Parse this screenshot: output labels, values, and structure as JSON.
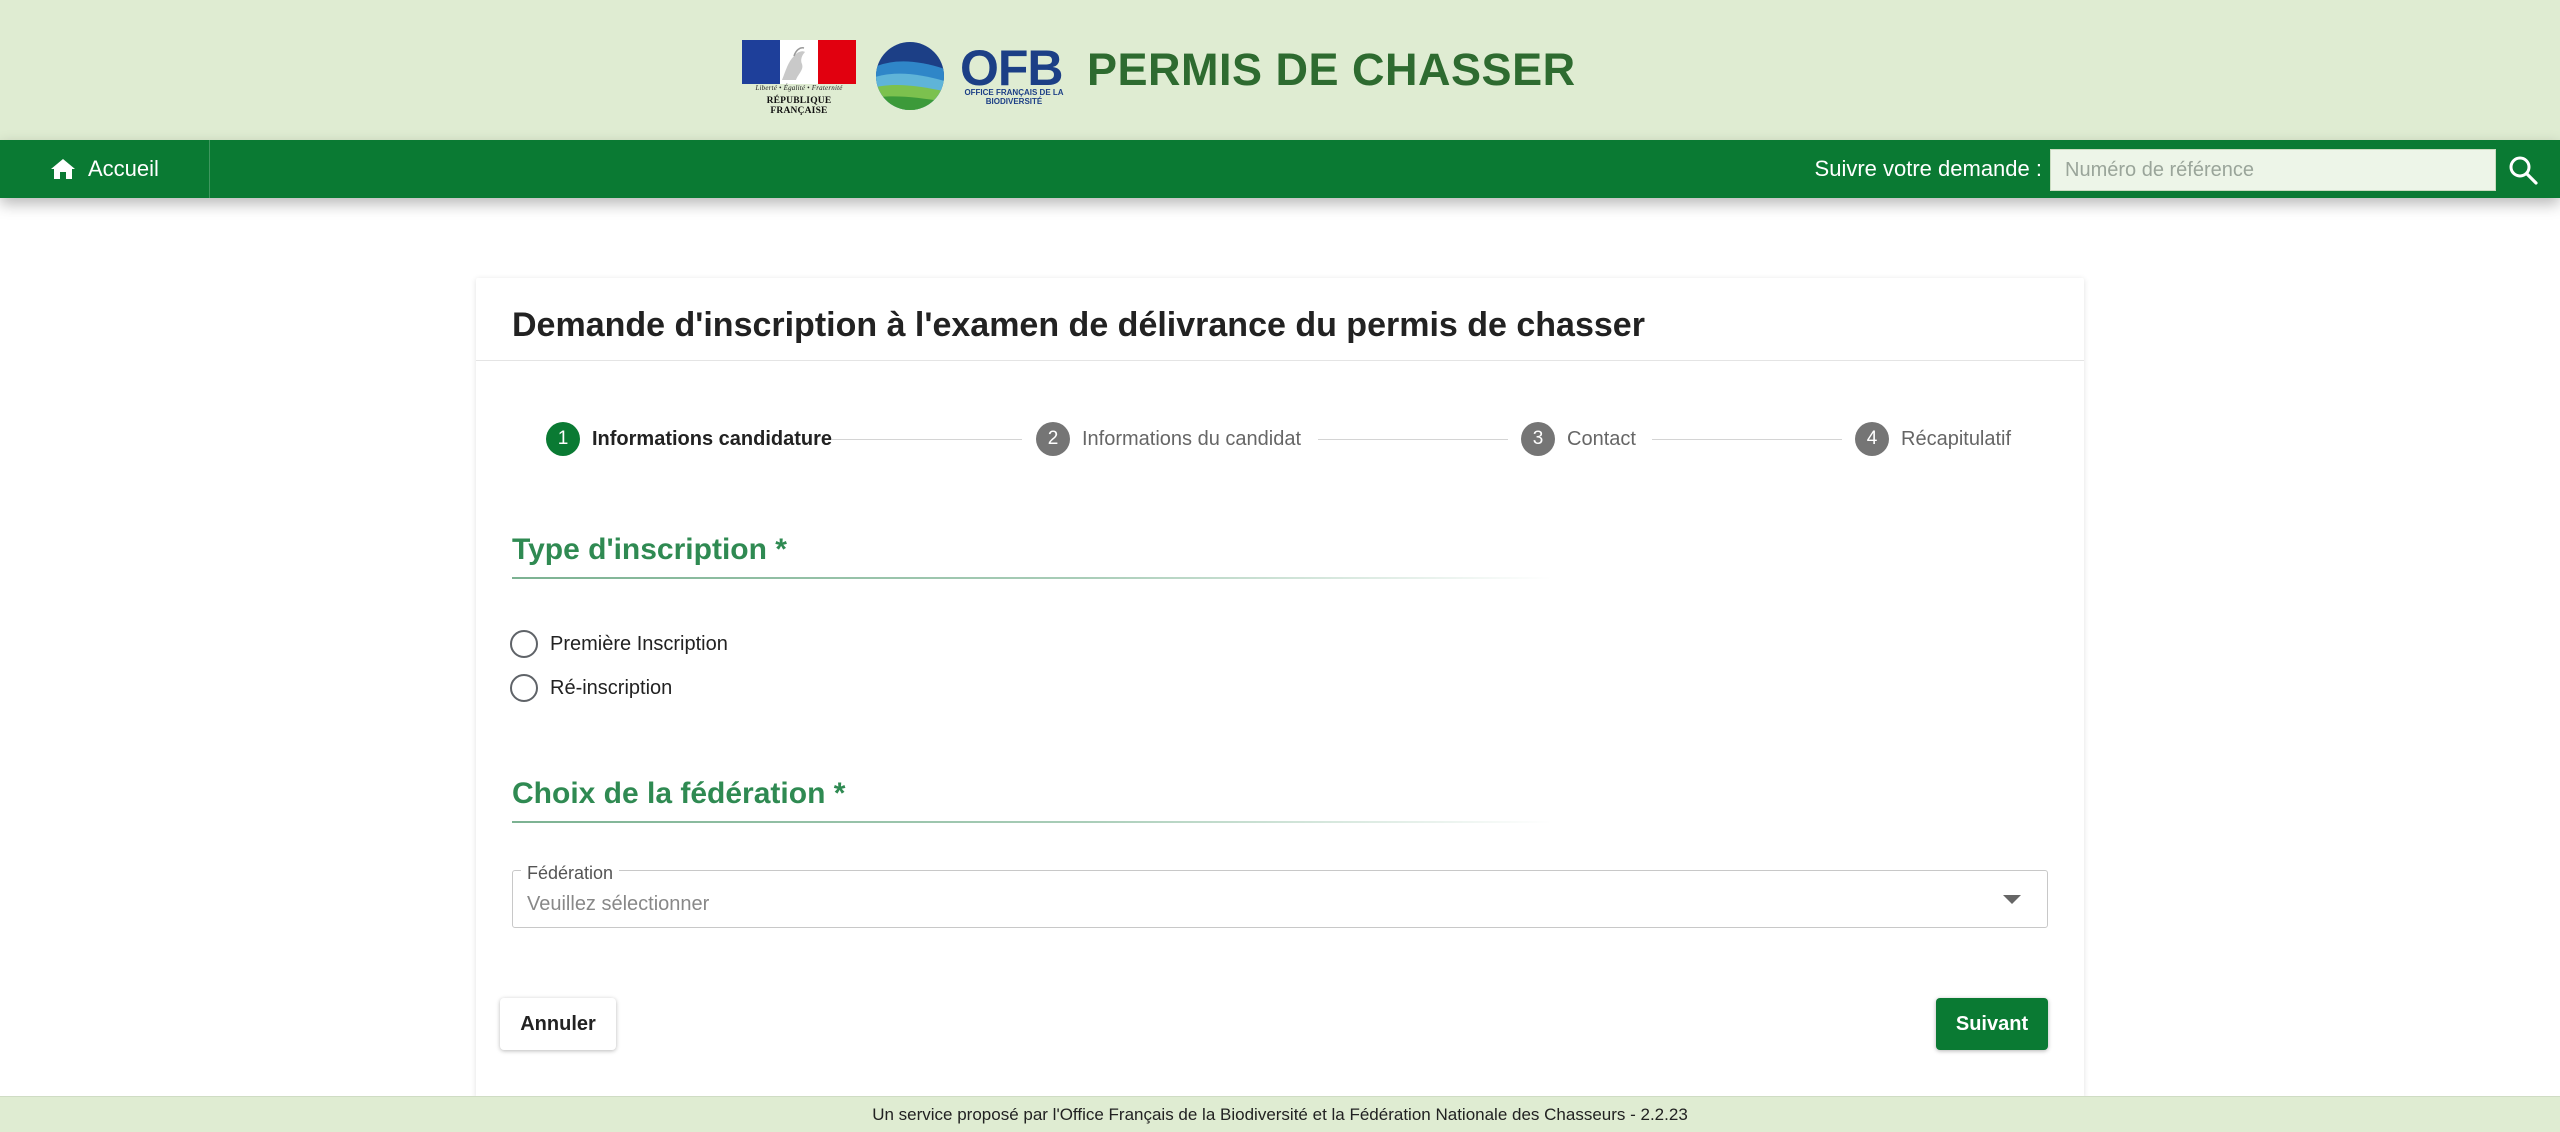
{
  "header": {
    "republique_motto": "Liberté • Égalité • Fraternité",
    "republique_name": "RÉPUBLIQUE FRANÇAISE",
    "ofb_logo_text": "OFB",
    "ofb_logo_subtext": "OFFICE FRANÇAIS DE LA BIODIVERSITÉ",
    "app_title": "PERMIS DE CHASSER"
  },
  "nav": {
    "home_label": "Accueil",
    "track_label": "Suivre votre demande :",
    "track_placeholder": "Numéro de référence"
  },
  "form": {
    "title": "Demande d'inscription à l'examen de délivrance du permis de chasser",
    "steps": [
      {
        "number": "1",
        "label": "Informations candidature",
        "active": true
      },
      {
        "number": "2",
        "label": "Informations du candidat",
        "active": false
      },
      {
        "number": "3",
        "label": "Contact",
        "active": false
      },
      {
        "number": "4",
        "label": "Récapitulatif",
        "active": false
      }
    ],
    "registration_type": {
      "title": "Type d'inscription *",
      "options": [
        "Première Inscription",
        "Ré-inscription"
      ],
      "selected": null
    },
    "federation": {
      "title": "Choix de la fédération *",
      "field_label": "Fédération",
      "placeholder": "Veuillez sélectionner"
    },
    "buttons": {
      "cancel": "Annuler",
      "next": "Suivant"
    }
  },
  "footer": {
    "text": "Un service proposé par l'Office Français de la Biodiversité et la Fédération Nationale des Chasseurs - 2.2.23"
  },
  "colors": {
    "header_bg": "#dfecd2",
    "primary_green": "#0a7a33",
    "title_green": "#2e6b30",
    "section_green": "#2f8a52",
    "inactive_step": "#757575"
  }
}
